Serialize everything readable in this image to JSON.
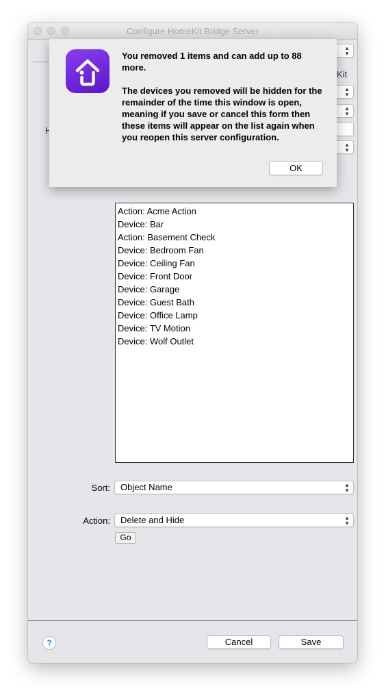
{
  "window": {
    "title": "Configure HomeKit Bridge Server"
  },
  "background_form": {
    "partial_label_kit": "Kit",
    "partial_label_h": "H"
  },
  "device_list": {
    "items": [
      "Action: Acme Action",
      "Device: Bar",
      "Action: Basement Check",
      "Device: Bedroom Fan",
      "Device: Ceiling Fan",
      "Device: Front Door",
      "Device: Garage",
      "Device: Guest Bath",
      "Device: Office Lamp",
      "Device: TV Motion",
      "Device: Wolf Outlet"
    ]
  },
  "sort": {
    "label": "Sort:",
    "selected": "Object Name"
  },
  "action": {
    "label": "Action:",
    "selected": "Delete and Hide",
    "go_label": "Go"
  },
  "footer": {
    "help_label": "?",
    "cancel_label": "Cancel",
    "save_label": "Save"
  },
  "alert": {
    "title": "You removed 1 items and can add up to 88 more.",
    "body": "The devices you removed will be hidden for the remainder of the time this window is open, meaning if you save or cancel this form then these items will appear on the list again when you reopen this server configuration.",
    "ok_label": "OK"
  },
  "colors": {
    "window_bg": "#e6e5e9",
    "app_icon_top": "#8a3df0",
    "app_icon_bottom": "#5b16c9",
    "help_accent": "#3b82f6"
  },
  "icons": {
    "app": "homekit-bridge-app-icon",
    "popup": "chevron-up-down-icon",
    "help": "help-icon"
  }
}
